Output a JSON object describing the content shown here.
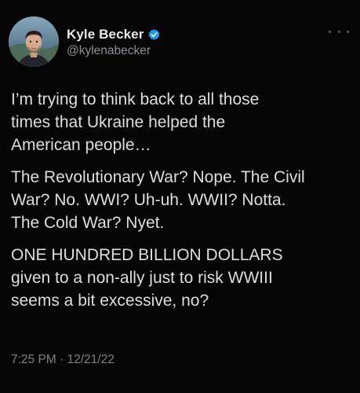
{
  "user": {
    "display_name": "Kyle Becker",
    "handle": "@kylenabecker",
    "verified": true
  },
  "tweet": {
    "paragraphs": [
      "I’m trying to think back to all those\ntimes that Ukraine helped the\nAmerican people…",
      "The Revolutionary War? Nope. The Civil\nWar? No. WWI? Uh-uh. WWII? Notta.\nThe Cold War? Nyet.",
      "ONE HUNDRED BILLION DOLLARS\ngiven to a non-ally just to risk WWIII\nseems a bit excessive, no?"
    ],
    "time": "7:25 PM",
    "date": "12/21/22",
    "timestamp_text": "7:25 PM · 12/21/22"
  },
  "colors": {
    "background": "#000000",
    "text": "#e7e9ea",
    "muted": "#8b9097",
    "verified_badge": "#1d9bf0"
  },
  "icons": {
    "verified": "verified-badge-icon",
    "more": "more-options-icon"
  }
}
